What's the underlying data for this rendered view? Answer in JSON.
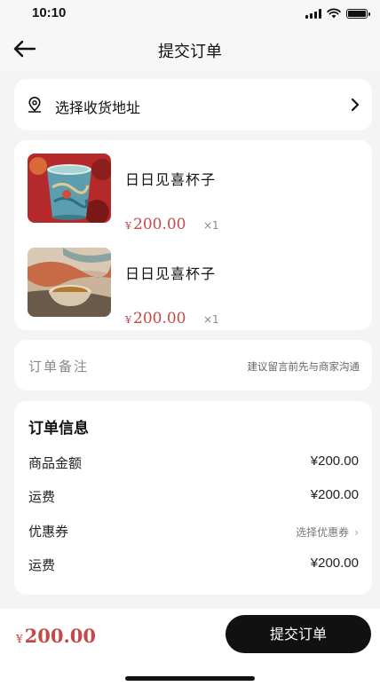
{
  "status_bar": {
    "time": "10:10"
  },
  "nav": {
    "title": "提交订单"
  },
  "address": {
    "label": "选择收货地址"
  },
  "products": [
    {
      "name": "日日见喜杯子",
      "currency": "¥",
      "price": "200.00",
      "qty": "×1"
    },
    {
      "name": "日日见喜杯子",
      "currency": "¥",
      "price": "200.00",
      "qty": "×1"
    }
  ],
  "remark": {
    "label": "订单备注",
    "hint": "建议留言前先与商家沟通"
  },
  "order_info": {
    "title": "订单信息",
    "rows": [
      {
        "label": "商品金额",
        "value": "¥200.00"
      },
      {
        "label": "运费",
        "value": "¥200.00"
      },
      {
        "label": "优惠券",
        "value": "选择优惠券"
      },
      {
        "label": "运费",
        "value": "¥200.00"
      }
    ]
  },
  "footer": {
    "currency": "¥",
    "total": "200.00",
    "submit_label": "提交订单"
  },
  "colors": {
    "accent_price": "#c44a4a",
    "button_bg": "#111111",
    "page_bg": "#f4f4f4"
  }
}
